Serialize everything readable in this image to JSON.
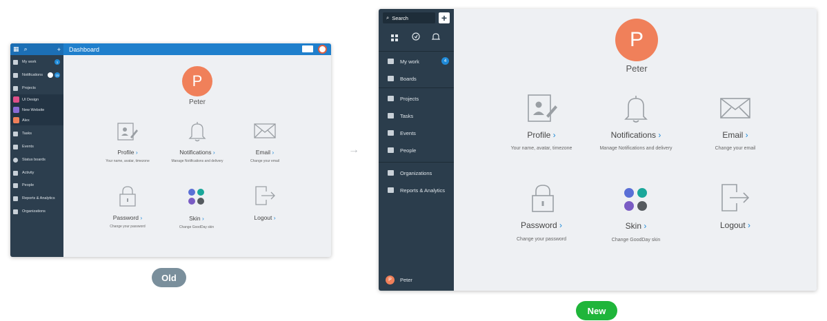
{
  "arrow": "→",
  "old": {
    "topbar_title": "Dashboard",
    "sidebar": {
      "items": [
        {
          "label": "My work",
          "badge": "1"
        },
        {
          "label": "Notifications",
          "badge": "15"
        },
        {
          "label": "Projects"
        },
        {
          "label": "UI Design"
        },
        {
          "label": "New Website"
        },
        {
          "label": "Alex"
        },
        {
          "label": "Tasks"
        },
        {
          "label": "Events"
        },
        {
          "label": "Status boards"
        },
        {
          "label": "Activity"
        },
        {
          "label": "People"
        },
        {
          "label": "Reports & Analytics"
        },
        {
          "label": "Organizations"
        }
      ]
    },
    "profile": {
      "initial": "P",
      "name": "Peter"
    },
    "cards": {
      "profile": {
        "title": "Profile",
        "desc": "Your name, avatar, timezone"
      },
      "notifications": {
        "title": "Notifications",
        "desc": "Manage Notifications and delivery"
      },
      "email": {
        "title": "Email",
        "desc": "Change your email"
      },
      "password": {
        "title": "Password",
        "desc": "Change your password"
      },
      "skin": {
        "title": "Skin",
        "desc": "Change GoodDay skin"
      },
      "logout": {
        "title": "Logout",
        "desc": ""
      }
    },
    "chevron": "›",
    "caption": "Old"
  },
  "new": {
    "search_label": "Search",
    "plus_label": "+",
    "sidebar": {
      "items": [
        {
          "label": "My work",
          "badge": "4"
        },
        {
          "label": "Boards"
        },
        {
          "label": "Projects"
        },
        {
          "label": "Tasks"
        },
        {
          "label": "Events"
        },
        {
          "label": "People"
        },
        {
          "label": "Organizations"
        },
        {
          "label": "Reports & Analytics"
        }
      ],
      "user": {
        "initial": "P",
        "name": "Peter"
      }
    },
    "profile": {
      "initial": "P",
      "name": "Peter"
    },
    "cards": {
      "profile": {
        "title": "Profile",
        "desc": "Your name, avatar, timezone"
      },
      "notifications": {
        "title": "Notifications",
        "desc": "Manage Notifications and delivery"
      },
      "email": {
        "title": "Email",
        "desc": "Change your email"
      },
      "password": {
        "title": "Password",
        "desc": "Change your password"
      },
      "skin": {
        "title": "Skin",
        "desc": "Change GoodDay skin"
      },
      "logout": {
        "title": "Logout",
        "desc": ""
      }
    },
    "chevron": "›",
    "caption": "New"
  },
  "colors": {
    "avatar": "#f0805a",
    "old_badge": "#7a8f9c",
    "new_badge": "#1fb53a",
    "skin_dots": [
      "#5a6fd6",
      "#1aa79a",
      "#7a5cc4",
      "#555a5f"
    ]
  }
}
